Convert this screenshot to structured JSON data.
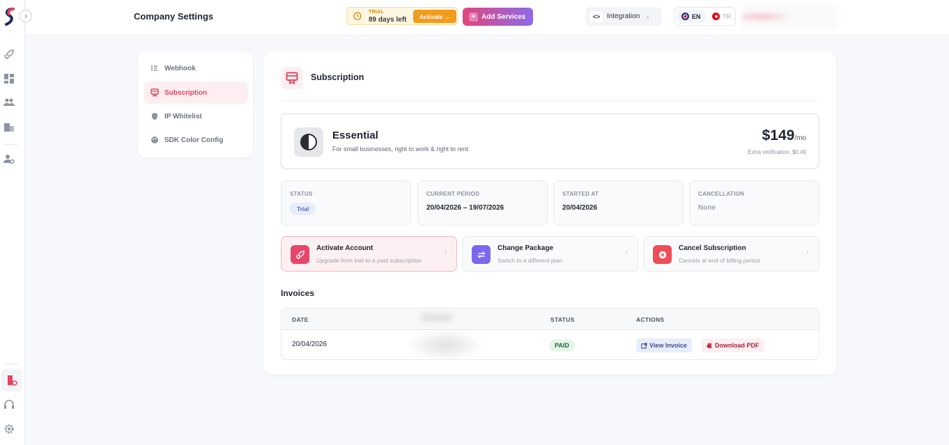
{
  "header": {
    "title": "Company Settings",
    "trial_label": "TRIAL",
    "trial_days": "89 days left",
    "activate_label": "Activate →",
    "add_services_label": "Add Services",
    "integration_label": "Integration",
    "lang_en": "EN",
    "lang_tr": "TR"
  },
  "menu": {
    "items": [
      {
        "label": "Webhook"
      },
      {
        "label": "Subscription"
      },
      {
        "label": "IP Whitelist"
      },
      {
        "label": "SDK Color Config"
      }
    ]
  },
  "panel": {
    "title": "Subscription",
    "plan": {
      "name": "Essential",
      "desc": "For small businesses, right to work & right to rent",
      "price": "$149",
      "period": "/mo",
      "extra": "Extra verification: $0.49"
    },
    "stats": [
      {
        "label": "STATUS",
        "value": "Trial"
      },
      {
        "label": "CURRENT PERIOD",
        "value": "20/04/2026 – 19/07/2026"
      },
      {
        "label": "STARTED AT",
        "value": "20/04/2026"
      },
      {
        "label": "CANCELLATION",
        "value": "None"
      }
    ],
    "actions": [
      {
        "title": "Activate Account",
        "sub": "Upgrade from trial to a paid subscription"
      },
      {
        "title": "Change Package",
        "sub": "Switch to a different plan"
      },
      {
        "title": "Cancel Subscription",
        "sub": "Cancels at end of billing period"
      }
    ],
    "invoices_title": "Invoices",
    "table": {
      "headers": [
        "DATE",
        "STATUS",
        "ACTIONS"
      ],
      "rows": [
        {
          "date": "20/04/2026",
          "status": "PAID",
          "view": "View Invoice",
          "download": "Download PDF"
        }
      ]
    }
  },
  "colors": {
    "accent": "#e04561",
    "trial": "#f29c1f",
    "purple": "#7b68ee"
  }
}
